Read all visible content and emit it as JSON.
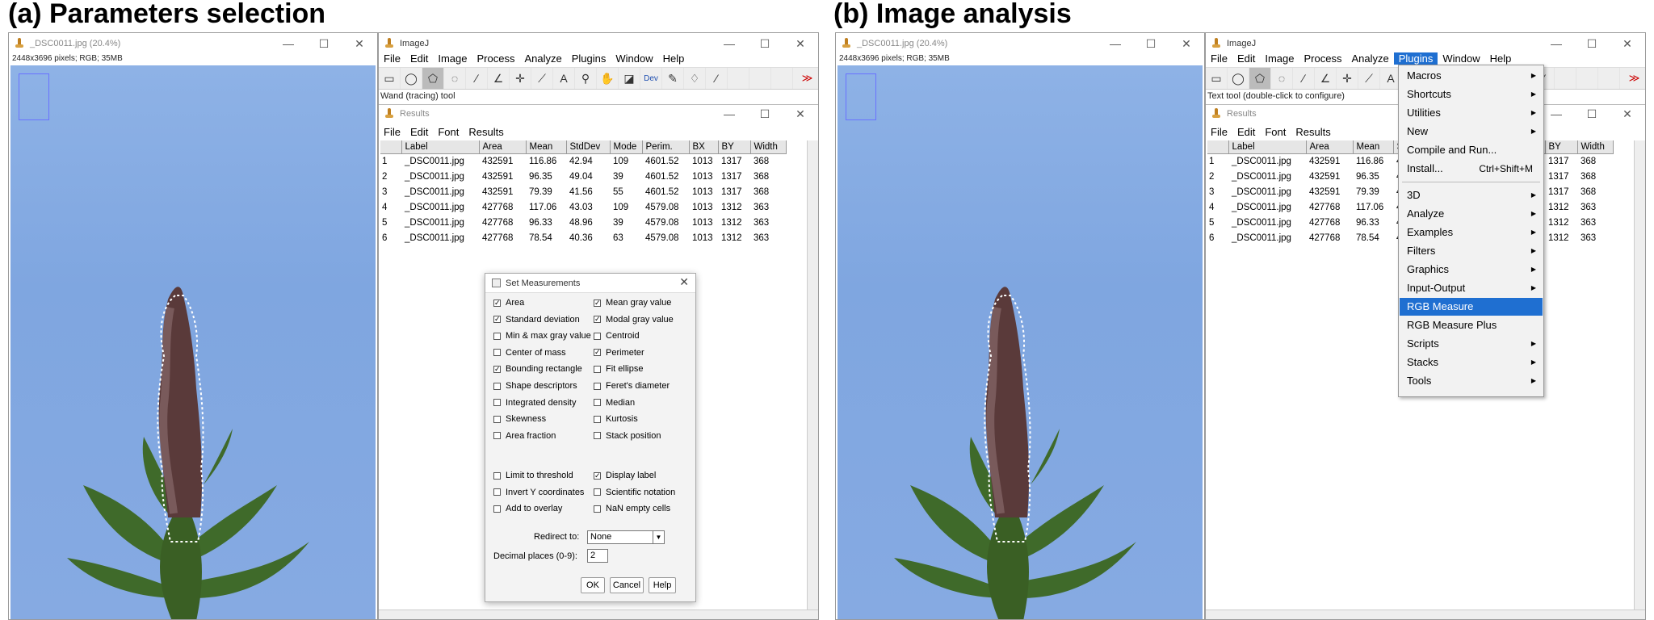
{
  "panels": {
    "a_title": "(a) Parameters selection",
    "b_title": "(b) Image analysis"
  },
  "image_window": {
    "title": "_DSC0011.jpg (20.4%)",
    "info": "2448x3696 pixels; RGB; 35MB"
  },
  "imagej": {
    "title": "ImageJ",
    "menus": [
      "File",
      "Edit",
      "Image",
      "Process",
      "Analyze",
      "Plugins",
      "Window",
      "Help"
    ],
    "status_a": "Wand (tracing) tool",
    "status_b": "Text tool (double-click to configure)",
    "overflow_icon": "double-chevron-right-icon"
  },
  "results": {
    "title": "Results",
    "menus": [
      "File",
      "Edit",
      "Font",
      "Results"
    ],
    "columns": [
      "",
      "Label",
      "Area",
      "Mean",
      "StdDev",
      "Mode",
      "Perim.",
      "BX",
      "BY",
      "Width"
    ],
    "rows": [
      [
        "1",
        "_DSC0011.jpg",
        "432591",
        "116.86",
        "42.94",
        "109",
        "4601.52",
        "1013",
        "1317",
        "368"
      ],
      [
        "2",
        "_DSC0011.jpg",
        "432591",
        "96.35",
        "49.04",
        "39",
        "4601.52",
        "1013",
        "1317",
        "368"
      ],
      [
        "3",
        "_DSC0011.jpg",
        "432591",
        "79.39",
        "41.56",
        "55",
        "4601.52",
        "1013",
        "1317",
        "368"
      ],
      [
        "4",
        "_DSC0011.jpg",
        "427768",
        "117.06",
        "43.03",
        "109",
        "4579.08",
        "1013",
        "1312",
        "363"
      ],
      [
        "5",
        "_DSC0011.jpg",
        "427768",
        "96.33",
        "48.96",
        "39",
        "4579.08",
        "1013",
        "1312",
        "363"
      ],
      [
        "6",
        "_DSC0011.jpg",
        "427768",
        "78.54",
        "40.36",
        "63",
        "4579.08",
        "1013",
        "1312",
        "363"
      ]
    ]
  },
  "set_measurements": {
    "title": "Set Measurements",
    "left": [
      {
        "label": "Area",
        "checked": true
      },
      {
        "label": "Standard deviation",
        "checked": true
      },
      {
        "label": "Min & max gray value",
        "checked": false
      },
      {
        "label": "Center of mass",
        "checked": false
      },
      {
        "label": "Bounding rectangle",
        "checked": true
      },
      {
        "label": "Shape descriptors",
        "checked": false
      },
      {
        "label": "Integrated density",
        "checked": false
      },
      {
        "label": "Skewness",
        "checked": false
      },
      {
        "label": "Area fraction",
        "checked": false
      }
    ],
    "right": [
      {
        "label": "Mean gray value",
        "checked": true
      },
      {
        "label": "Modal gray value",
        "checked": true
      },
      {
        "label": "Centroid",
        "checked": false
      },
      {
        "label": "Perimeter",
        "checked": true
      },
      {
        "label": "Fit ellipse",
        "checked": false
      },
      {
        "label": "Feret's diameter",
        "checked": false
      },
      {
        "label": "Median",
        "checked": false
      },
      {
        "label": "Kurtosis",
        "checked": false
      },
      {
        "label": "Stack position",
        "checked": false
      }
    ],
    "left2": [
      {
        "label": "Limit to threshold",
        "checked": false
      },
      {
        "label": "Invert Y coordinates",
        "checked": false
      },
      {
        "label": "Add to overlay",
        "checked": false
      }
    ],
    "right2": [
      {
        "label": "Display label",
        "checked": true
      },
      {
        "label": "Scientific notation",
        "checked": false
      },
      {
        "label": "NaN empty cells",
        "checked": false
      }
    ],
    "redirect_label": "Redirect to:",
    "redirect_value": "None",
    "decimal_label": "Decimal places (0-9):",
    "decimal_value": "2",
    "ok": "OK",
    "cancel": "Cancel",
    "help": "Help"
  },
  "plugins_menu": {
    "items": [
      {
        "label": "Macros",
        "sub": true
      },
      {
        "label": "Shortcuts",
        "sub": true
      },
      {
        "label": "Utilities",
        "sub": true
      },
      {
        "label": "New",
        "sub": true
      },
      {
        "label": "Compile and Run...",
        "sub": false
      },
      {
        "label": "Install...",
        "sub": false,
        "shortcut": "Ctrl+Shift+M"
      },
      {
        "sep": true
      },
      {
        "label": "3D",
        "sub": true
      },
      {
        "label": "Analyze",
        "sub": true
      },
      {
        "label": "Examples",
        "sub": true
      },
      {
        "label": "Filters",
        "sub": true
      },
      {
        "label": "Graphics",
        "sub": true
      },
      {
        "label": "Input-Output",
        "sub": true
      },
      {
        "label": "RGB Measure",
        "sub": false,
        "highlight": true
      },
      {
        "label": "RGB Measure Plus",
        "sub": false
      },
      {
        "label": "Scripts",
        "sub": true
      },
      {
        "label": "Stacks",
        "sub": true
      },
      {
        "label": "Tools",
        "sub": true
      }
    ]
  },
  "colors": {
    "accent": "#1f6fd1",
    "background_blue": "#86aae2"
  }
}
